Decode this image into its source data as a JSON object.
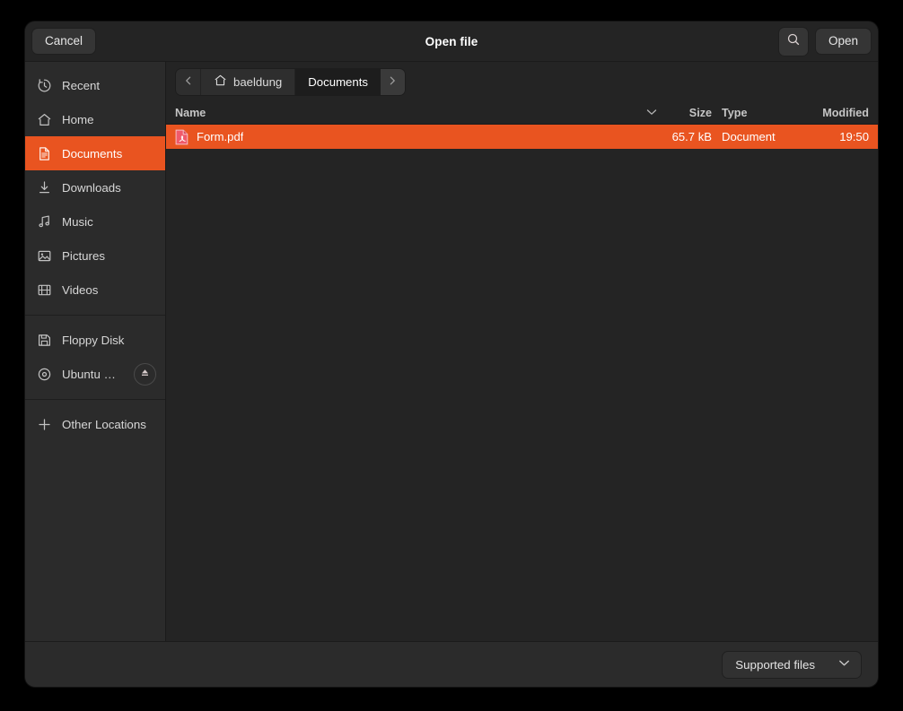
{
  "window": {
    "title": "Open file"
  },
  "header": {
    "cancel_label": "Cancel",
    "open_label": "Open",
    "search_icon": "search-icon"
  },
  "sidebar": {
    "items": [
      {
        "label": "Recent",
        "icon": "clock-icon",
        "selected": false
      },
      {
        "label": "Home",
        "icon": "home-icon",
        "selected": false
      },
      {
        "label": "Documents",
        "icon": "document-icon",
        "selected": true
      },
      {
        "label": "Downloads",
        "icon": "download-icon",
        "selected": false
      },
      {
        "label": "Music",
        "icon": "music-note-icon",
        "selected": false
      },
      {
        "label": "Pictures",
        "icon": "image-icon",
        "selected": false
      },
      {
        "label": "Videos",
        "icon": "film-icon",
        "selected": false
      }
    ],
    "devices": [
      {
        "label": "Floppy Disk",
        "icon": "floppy-disk-icon",
        "eject": false
      },
      {
        "label": "Ubuntu …",
        "icon": "optical-disc-icon",
        "eject": true
      }
    ],
    "other": {
      "label": "Other Locations",
      "icon": "plus-icon"
    }
  },
  "pathbar": {
    "back_icon": "chevron-left-icon",
    "forward_icon": "chevron-right-icon",
    "crumbs": [
      {
        "label": "baeldung",
        "icon": "home-icon",
        "current": false
      },
      {
        "label": "Documents",
        "icon": "",
        "current": true
      }
    ]
  },
  "columns": {
    "name": "Name",
    "size": "Size",
    "type": "Type",
    "modified": "Modified",
    "sort_icon": "chevron-down-icon"
  },
  "files": [
    {
      "name": "Form.pdf",
      "size": "65.7 kB",
      "type": "Document",
      "modified": "19:50",
      "icon": "pdf-file-icon",
      "selected": true
    }
  ],
  "footer": {
    "filter_label": "Supported files",
    "filter_chevron": "chevron-down-icon"
  },
  "colors": {
    "accent": "#e95420",
    "window_bg": "#242424",
    "sidebar_bg": "#2b2b2b",
    "desktop_bg": "#000000"
  }
}
